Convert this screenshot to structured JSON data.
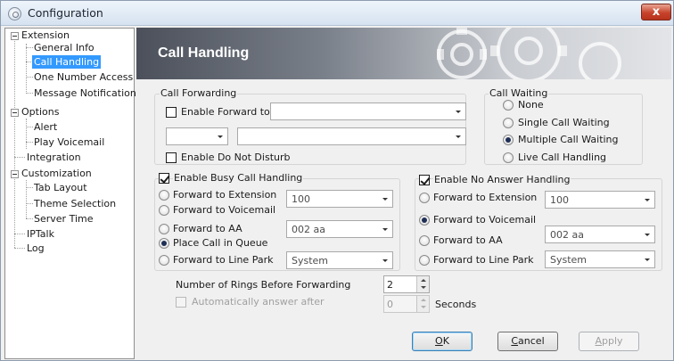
{
  "window": {
    "title": "Configuration",
    "close_glyph": "x"
  },
  "tree": {
    "extension": "Extension",
    "general_info": "General Info",
    "call_handling": "Call Handling",
    "one_number_access": "One Number Access",
    "message_notification": "Message Notification",
    "options": "Options",
    "alert": "Alert",
    "play_voicemail": "Play Voicemail",
    "integration": "Integration",
    "customization": "Customization",
    "tab_layout": "Tab Layout",
    "theme_selection": "Theme Selection",
    "server_time": "Server Time",
    "iptalk": "IPTalk",
    "log": "Log",
    "selected": "Call Handling"
  },
  "banner": {
    "title": "Call Handling"
  },
  "call_forwarding": {
    "group_label": "Call Forwarding",
    "enable_forward_to": {
      "label": "Enable Forward to",
      "checked": false
    },
    "forward_to_value": "",
    "small_select_value": "",
    "number_value": "",
    "enable_dnd": {
      "label": "Enable Do Not Disturb",
      "checked": false
    }
  },
  "call_waiting": {
    "group_label": "Call Waiting",
    "options": [
      "None",
      "Single Call Waiting",
      "Multiple Call Waiting",
      "Live Call Handling"
    ],
    "selected": "Multiple Call Waiting"
  },
  "busy": {
    "enable_label": "Enable Busy Call Handling",
    "enabled": true,
    "forward_to_extension": "Forward to Extension",
    "extension_value": "100",
    "forward_to_voicemail": "Forward to Voicemail",
    "forward_to_aa": "Forward to AA",
    "aa_value": "002 aa",
    "place_call_in_queue": "Place Call in Queue",
    "forward_to_line_park": "Forward to Line Park",
    "line_park_value": "System",
    "selected": "Place Call in Queue"
  },
  "no_answer": {
    "enable_label": "Enable No Answer Handling",
    "enabled": true,
    "forward_to_extension": "Forward to Extension",
    "extension_value": "100",
    "forward_to_voicemail": "Forward to Voicemail",
    "forward_to_aa": "Forward to AA",
    "aa_value": "002 aa",
    "forward_to_line_park": "Forward to Line Park",
    "line_park_value": "System",
    "selected": "Forward to Voicemail"
  },
  "rings": {
    "label": "Number of Rings Before Forwarding",
    "value": "2"
  },
  "auto_answer": {
    "label": "Automatically answer after",
    "checked": false,
    "value": "0",
    "unit": "Seconds"
  },
  "buttons": {
    "ok_key": "O",
    "ok_rest": "K",
    "cancel_key": "C",
    "cancel_rest": "ancel",
    "apply_key": "A",
    "apply_rest": "pply"
  },
  "colors": {
    "selection": "#3399ff",
    "close_button": "#c7432b",
    "banner_dark": "#4b505a"
  }
}
